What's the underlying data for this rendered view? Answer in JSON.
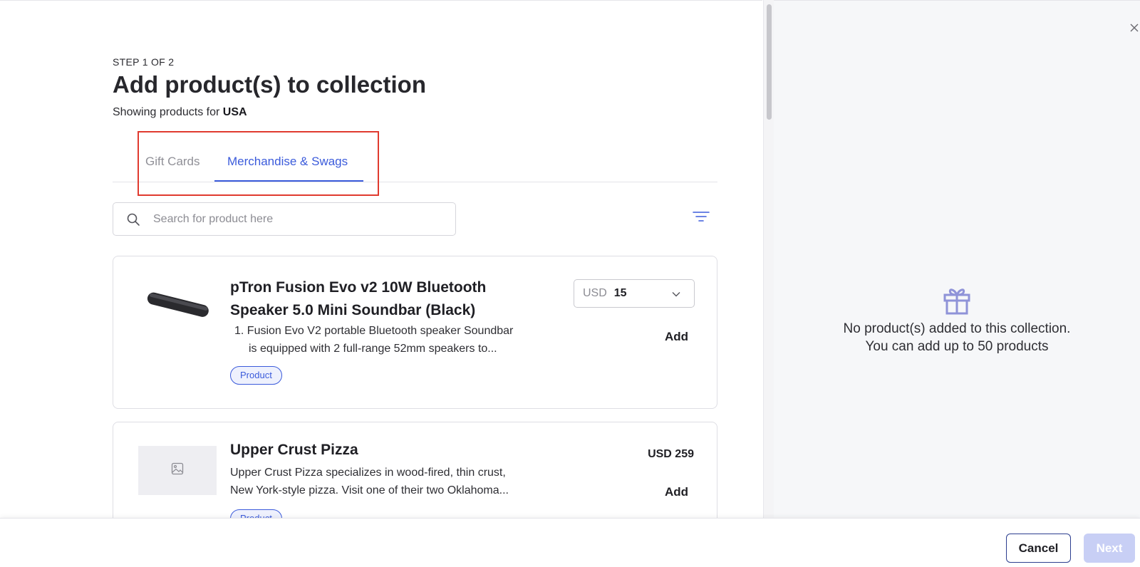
{
  "header": {
    "step": "STEP 1 OF 2",
    "title": "Add product(s) to collection",
    "subtitle_prefix": "Showing products for",
    "country": "USA"
  },
  "tabs": [
    {
      "label": "Gift Cards",
      "active": false
    },
    {
      "label": "Merchandise & Swags",
      "active": true
    }
  ],
  "search": {
    "placeholder": "Search for product here",
    "value": ""
  },
  "products": [
    {
      "name_line1": "pTron Fusion Evo v2 10W Bluetooth",
      "name_line2": "Speaker 5.0 Mini Soundbar (Black)",
      "desc_line1": "1. Fusion Evo V2 portable Bluetooth speaker Soundbar",
      "desc_line2": "is equipped with 2 full-range 52mm speakers to...",
      "badge": "Product",
      "currency": "USD",
      "price": "15",
      "add_label": "Add"
    },
    {
      "name": "Upper Crust Pizza",
      "desc_line1": "Upper Crust Pizza specializes in wood-fired, thin crust,",
      "desc_line2": "New York-style pizza. Visit one of their two Oklahoma...",
      "badge": "Product",
      "price_label": "USD 259",
      "add_label": "Add"
    }
  ],
  "collection_panel": {
    "empty_line1": "No product(s) added to this collection.",
    "empty_line2": "You can add up to 50 products"
  },
  "footer": {
    "cancel_label": "Cancel",
    "next_label": "Next"
  },
  "colors": {
    "accent": "#3b5bdb",
    "highlight": "#e03a2f",
    "gift_icon": "#8f93d8",
    "next_disabled": "#c8cff5"
  }
}
